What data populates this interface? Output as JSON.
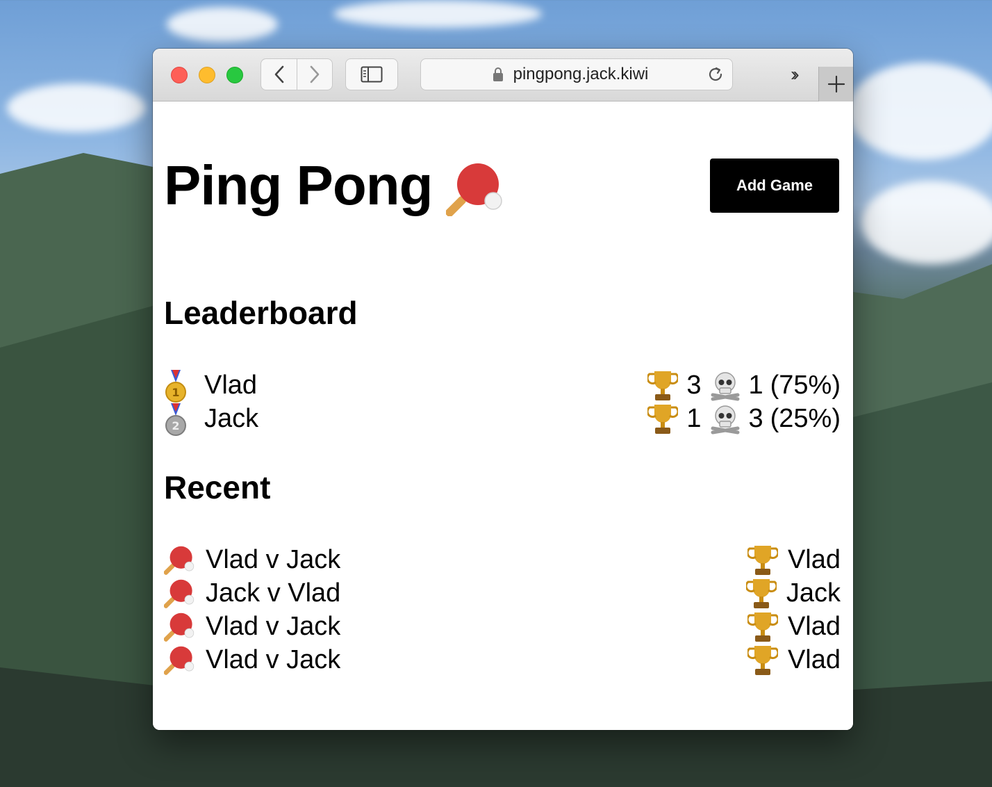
{
  "browser": {
    "url": "pingpong.jack.kiwi"
  },
  "page": {
    "title": "Ping Pong",
    "add_game_label": "Add Game"
  },
  "leaderboard": {
    "heading": "Leaderboard",
    "rows": [
      {
        "medal": "gold-medal-icon",
        "name": "Vlad",
        "wins": "3",
        "losses": "1",
        "pct": "(75%)"
      },
      {
        "medal": "silver-medal-icon",
        "name": "Jack",
        "wins": "1",
        "losses": "3",
        "pct": "(25%)"
      }
    ]
  },
  "recent": {
    "heading": "Recent",
    "games": [
      {
        "match": "Vlad v Jack",
        "winner": "Vlad"
      },
      {
        "match": "Jack v Vlad",
        "winner": "Jack"
      },
      {
        "match": "Vlad v Jack",
        "winner": "Vlad"
      },
      {
        "match": "Vlad v Jack",
        "winner": "Vlad"
      }
    ]
  },
  "colors": {
    "button_bg": "#000000",
    "paddle_red": "#d83a3a",
    "trophy_gold": "#e0a526"
  }
}
